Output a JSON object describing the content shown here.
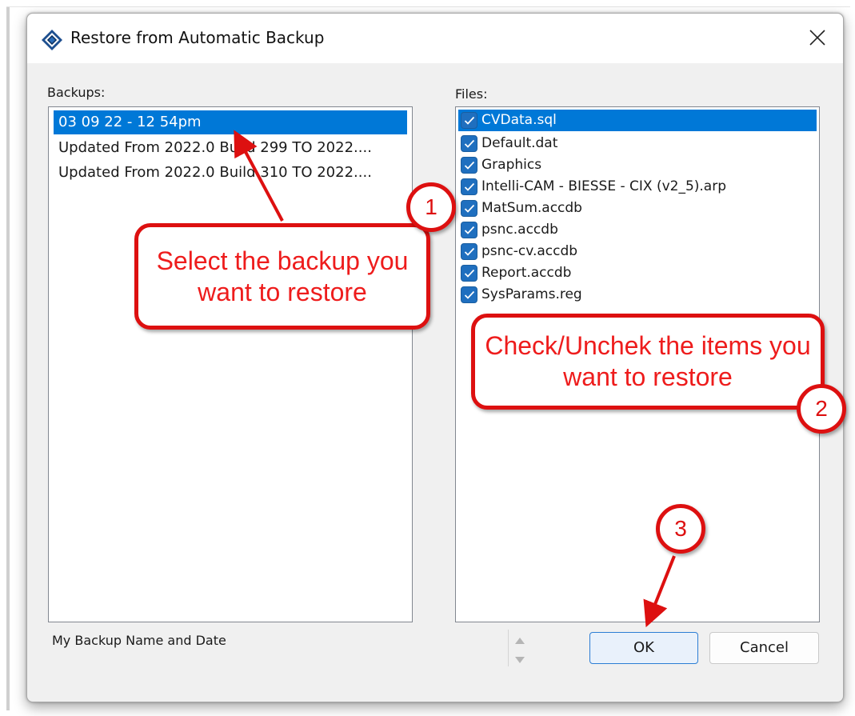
{
  "dialog": {
    "title": "Restore from Automatic Backup",
    "close_icon": "close-icon"
  },
  "backups": {
    "label": "Backups:",
    "items": [
      {
        "text": "03 09 22 - 12 54pm",
        "selected": true
      },
      {
        "text": "Updated From 2022.0 Build 299 TO 2022....",
        "selected": false
      },
      {
        "text": "Updated From 2022.0 Build 310 TO 2022....",
        "selected": false
      }
    ]
  },
  "files": {
    "label": "Files:",
    "items": [
      {
        "text": "CVData.sql",
        "checked": true,
        "selected": true
      },
      {
        "text": "Default.dat",
        "checked": true,
        "selected": false
      },
      {
        "text": "Graphics",
        "checked": true,
        "selected": false
      },
      {
        "text": "Intelli-CAM - BIESSE - CIX (v2_5).arp",
        "checked": true,
        "selected": false
      },
      {
        "text": "MatSum.accdb",
        "checked": true,
        "selected": false
      },
      {
        "text": "psnc.accdb",
        "checked": true,
        "selected": false
      },
      {
        "text": "psnc-cv.accdb",
        "checked": true,
        "selected": false
      },
      {
        "text": "Report.accdb",
        "checked": true,
        "selected": false
      },
      {
        "text": "SysParams.reg",
        "checked": true,
        "selected": false
      }
    ]
  },
  "footer": {
    "backup_name": "My Backup Name and Date",
    "ok_label": "OK",
    "cancel_label": "Cancel"
  },
  "annotations": {
    "callout_1": "Select the backup you want to restore",
    "callout_2": "Check/Unchek the items you want to restore",
    "badge_1": "1",
    "badge_2": "2",
    "badge_3": "3",
    "color": "#dd1010"
  },
  "colors": {
    "selection": "#0078d7",
    "checkbox": "#1f6fbf"
  }
}
